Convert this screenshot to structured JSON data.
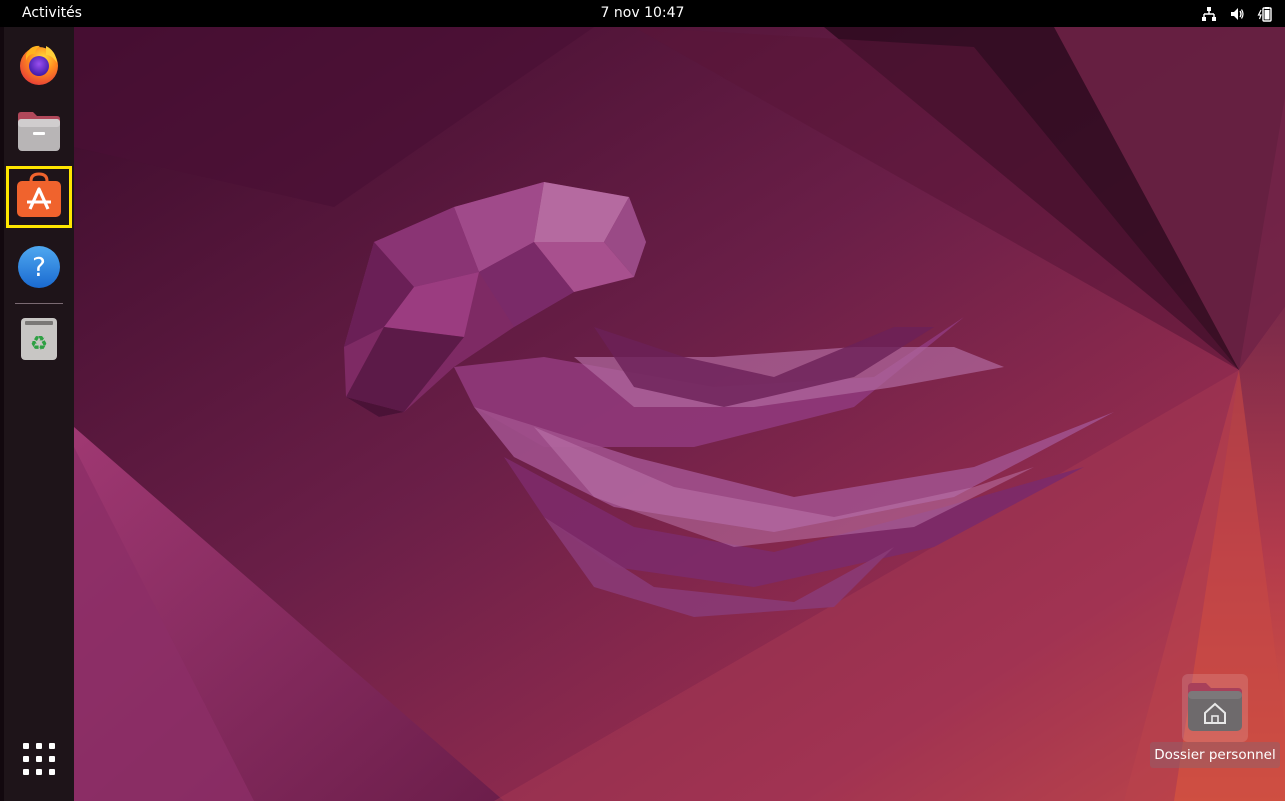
{
  "topbar": {
    "activities_label": "Activités",
    "clock": "7 nov  10:47",
    "tray_icons": [
      "network-icon",
      "volume-icon",
      "battery-icon"
    ]
  },
  "dock": {
    "items": [
      {
        "name": "Firefox",
        "icon": "firefox-icon"
      },
      {
        "name": "Fichiers",
        "icon": "files-icon"
      },
      {
        "name": "Ubuntu Software",
        "icon": "software-store-icon",
        "highlighted": true
      },
      {
        "name": "Aide",
        "icon": "help-icon"
      },
      {
        "name": "Corbeille",
        "icon": "trash-icon"
      }
    ],
    "show_apps_icon": "app-grid-icon"
  },
  "desktop": {
    "home_folder_label": "Dossier personnel",
    "home_folder_icon": "home-folder-icon"
  },
  "colors": {
    "highlight": "#ffe600",
    "topbar": "#000000",
    "dock": "#1e1419",
    "wallpaper_dark": "#3a0a2a",
    "wallpaper_mid": "#7a2452",
    "wallpaper_accent": "#c9454a"
  }
}
